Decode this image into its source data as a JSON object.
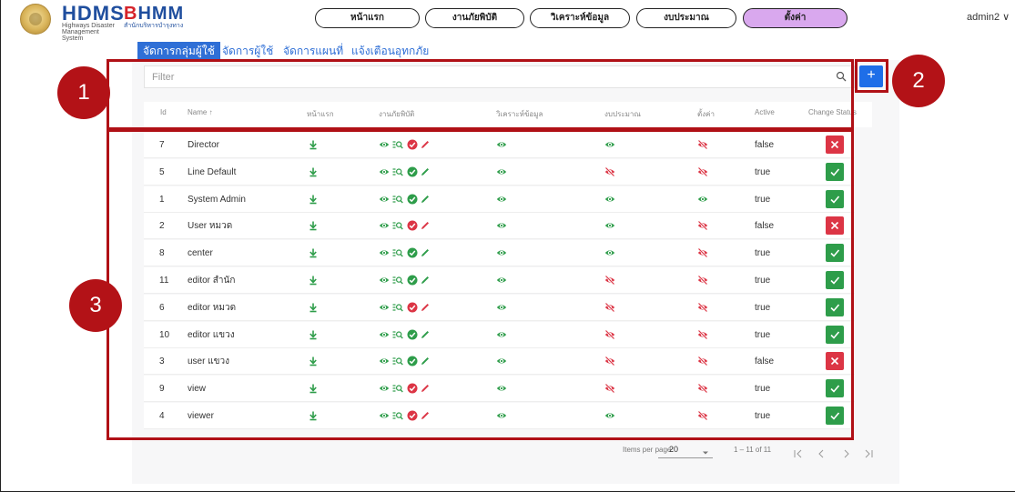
{
  "header": {
    "logo_main": "HDMS",
    "logo_sub": "Highways Disaster Management System",
    "brand_b": "B",
    "brand_rest": "HMM",
    "brand_sub": "สำนักบริหารบำรุงทาง",
    "nav": [
      {
        "label": "หน้าแรก",
        "active": false
      },
      {
        "label": "งานภัยพิบัติ",
        "active": false
      },
      {
        "label": "วิเคราะห์ข้อมูล",
        "active": false
      },
      {
        "label": "งบประมาณ",
        "active": false
      },
      {
        "label": "ตั้งค่า",
        "active": true
      }
    ],
    "user": "admin2 ∨"
  },
  "tabs": [
    {
      "label": "จัดการกลุ่มผู้ใช้",
      "active": true
    },
    {
      "label": "จัดการผู้ใช้",
      "active": false
    },
    {
      "label": "จัดการแผนที่",
      "active": false
    },
    {
      "label": "แจ้งเตือนอุทกภัย",
      "active": false
    }
  ],
  "filter": {
    "placeholder": "Filter"
  },
  "add_button": "+",
  "table": {
    "columns": [
      "Id",
      "Name ↑",
      "หน้าแรก",
      "งานภัยพิบัติ",
      "วิเคราะห์ข้อมูล",
      "งบประมาณ",
      "ตั้งค่า",
      "Active",
      "Change Status"
    ],
    "rows": [
      {
        "id": "7",
        "name": "Director",
        "check_ok": false,
        "analysis": true,
        "budget": true,
        "settings": false,
        "active": "false"
      },
      {
        "id": "5",
        "name": "Line Default",
        "check_ok": true,
        "analysis": true,
        "budget": false,
        "settings": false,
        "active": "true"
      },
      {
        "id": "1",
        "name": "System Admin",
        "check_ok": true,
        "analysis": true,
        "budget": true,
        "settings": true,
        "active": "true"
      },
      {
        "id": "2",
        "name": "User หมวด",
        "check_ok": false,
        "analysis": true,
        "budget": true,
        "settings": false,
        "active": "false"
      },
      {
        "id": "8",
        "name": "center",
        "check_ok": true,
        "analysis": true,
        "budget": true,
        "settings": false,
        "active": "true"
      },
      {
        "id": "11",
        "name": "editor สำนัก",
        "check_ok": true,
        "analysis": true,
        "budget": false,
        "settings": false,
        "active": "true"
      },
      {
        "id": "6",
        "name": "editor หมวด",
        "check_ok": false,
        "analysis": true,
        "budget": false,
        "settings": false,
        "active": "true"
      },
      {
        "id": "10",
        "name": "editor แขวง",
        "check_ok": true,
        "analysis": true,
        "budget": false,
        "settings": false,
        "active": "true"
      },
      {
        "id": "3",
        "name": "user แขวง",
        "check_ok": true,
        "analysis": true,
        "budget": false,
        "settings": false,
        "active": "false"
      },
      {
        "id": "9",
        "name": "view",
        "check_ok": false,
        "analysis": true,
        "budget": false,
        "settings": false,
        "active": "true"
      },
      {
        "id": "4",
        "name": "viewer",
        "check_ok": false,
        "analysis": true,
        "budget": true,
        "settings": false,
        "active": "true"
      }
    ]
  },
  "paginator": {
    "items_per_page_label": "Items per page:",
    "page_size": "20",
    "range": "1 – 11 of 11"
  },
  "annotations": [
    "1",
    "2",
    "3"
  ],
  "colors": {
    "primary": "#1e6ee8",
    "tab_blue": "#2f6fd6",
    "active_nav": "#d9a8ee",
    "success": "#2e9d4a",
    "danger": "#dc3545",
    "annotation": "#b31217"
  }
}
